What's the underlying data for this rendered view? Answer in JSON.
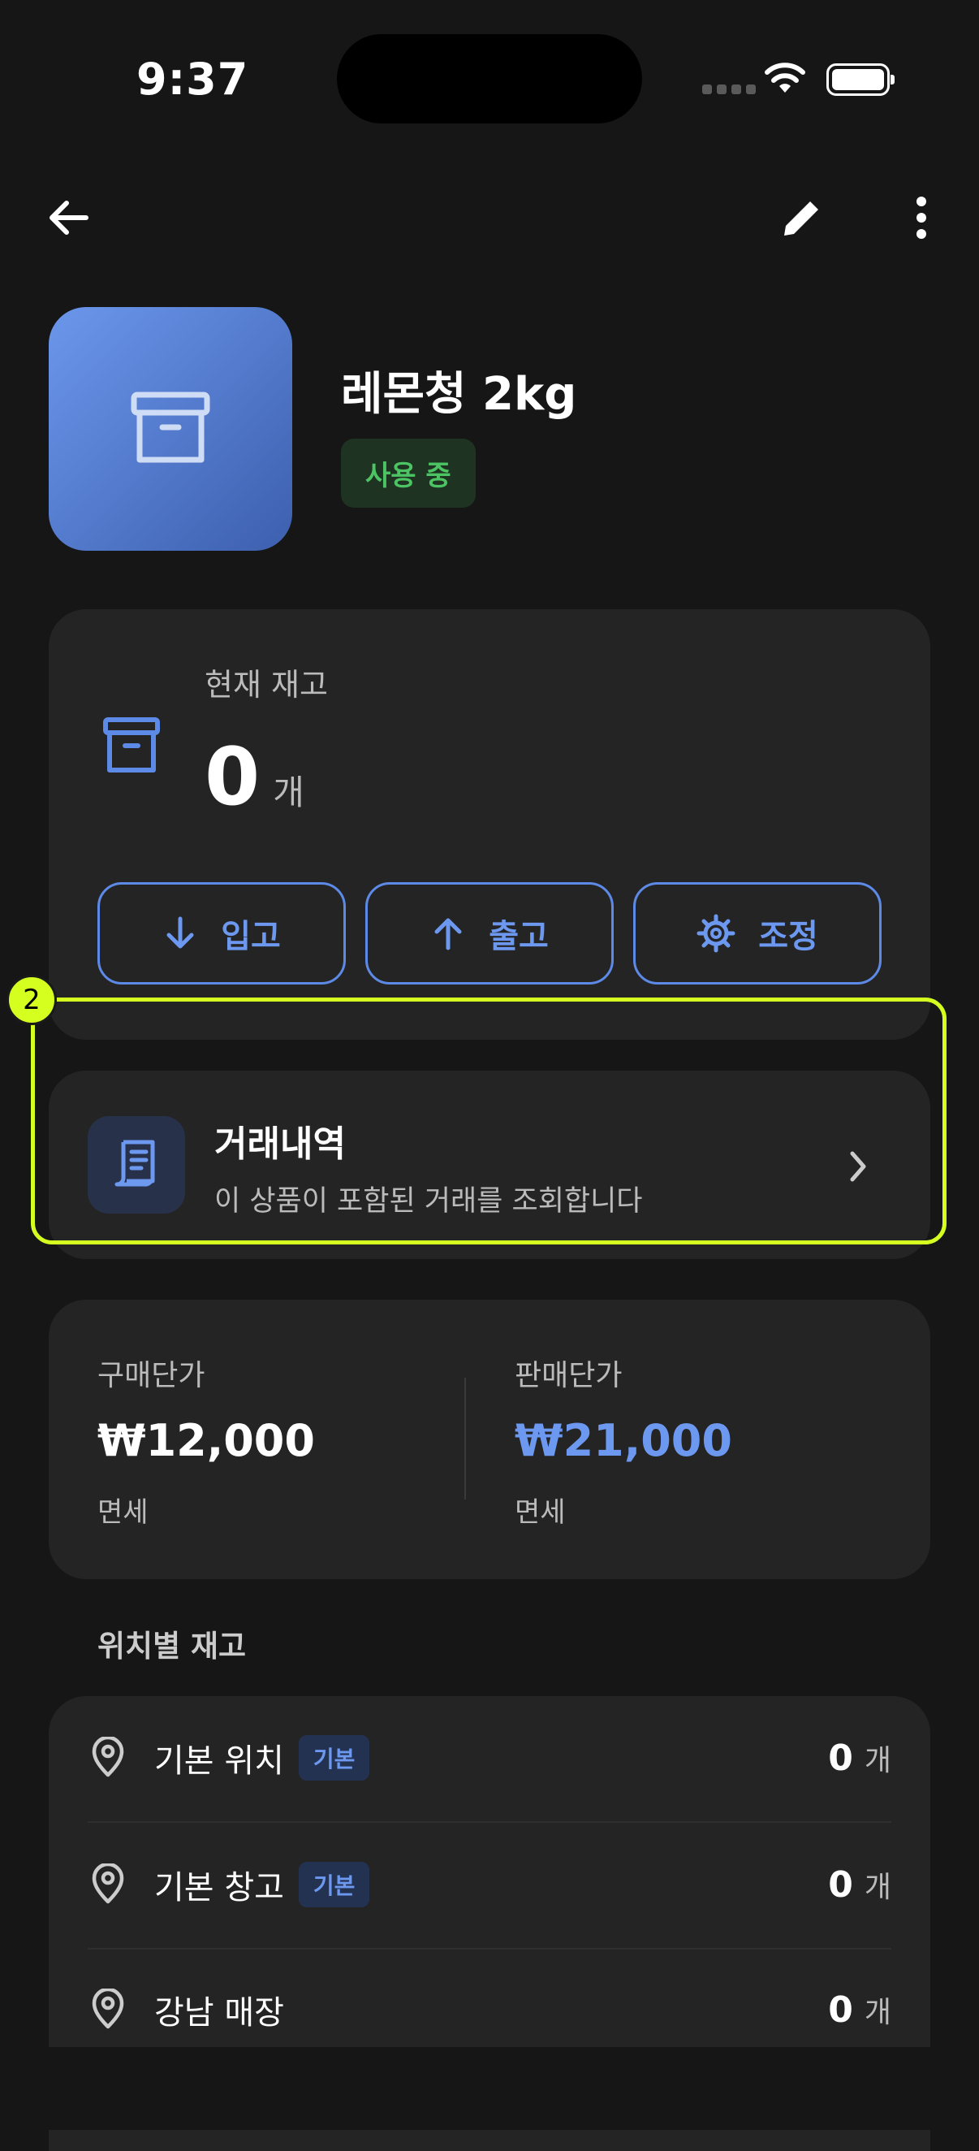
{
  "status_bar": {
    "time": "9:37"
  },
  "product": {
    "name": "레몬청 2kg",
    "status_badge": "사용 중"
  },
  "stock": {
    "label": "현재 재고",
    "value": "0",
    "unit": "개",
    "actions": {
      "in": "입고",
      "out": "출고",
      "adjust": "조정"
    }
  },
  "transactions": {
    "title": "거래내역",
    "subtitle": "이 상품이 포함된 거래를 조회합니다",
    "marker": "2"
  },
  "prices": {
    "purchase_label": "구매단가",
    "purchase_value": "₩12,000",
    "purchase_tax": "면세",
    "sale_label": "판매단가",
    "sale_value": "₩21,000",
    "sale_tax": "면세"
  },
  "locations": {
    "title": "위치별 재고",
    "items": [
      {
        "name": "기본 위치",
        "badge": "기본",
        "qty": "0",
        "unit": "개"
      },
      {
        "name": "기본 창고",
        "badge": "기본",
        "qty": "0",
        "unit": "개"
      },
      {
        "name": "강남 매장",
        "badge": "",
        "qty": "0",
        "unit": "개"
      }
    ]
  },
  "colors": {
    "background": "#161616",
    "card": "#242424",
    "accent_blue": "#5d8ae6",
    "status_green": "#4cc463",
    "highlight": "#d4ff1f"
  },
  "icons": [
    "back-arrow-icon",
    "pencil-icon",
    "more-vertical-icon",
    "archive-box-icon",
    "arrow-down-icon",
    "arrow-up-icon",
    "gear-icon",
    "receipt-icon",
    "chevron-right-icon",
    "location-pin-icon"
  ]
}
